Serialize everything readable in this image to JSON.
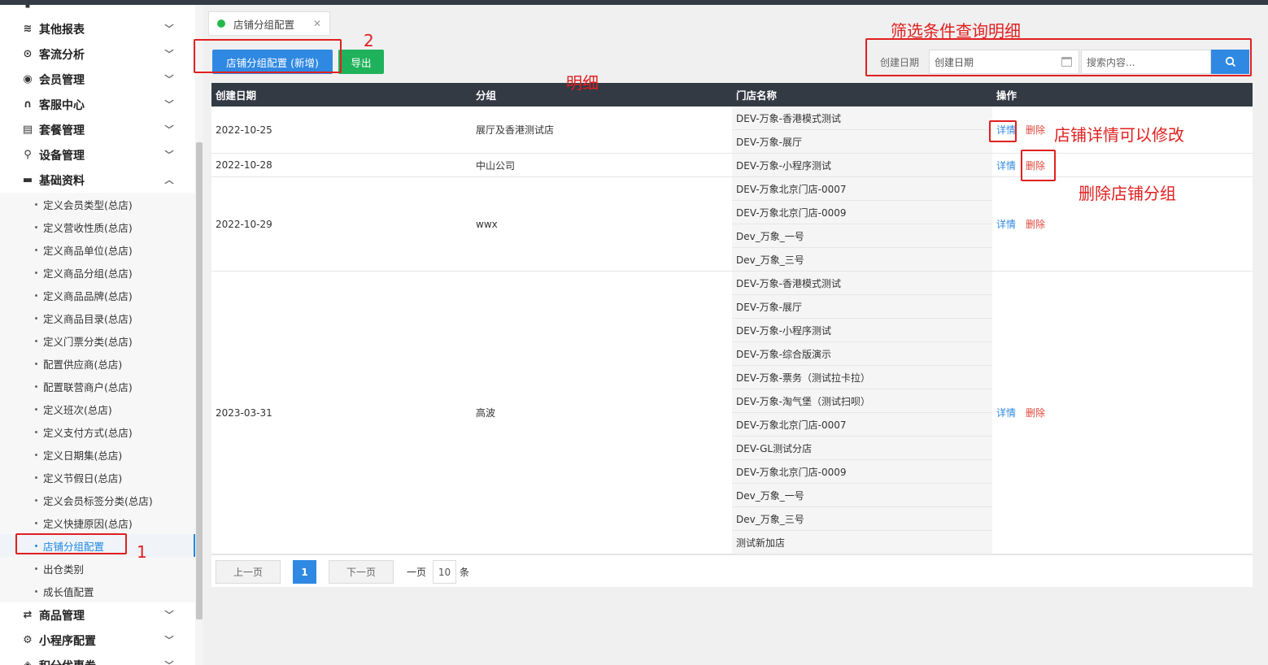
{
  "sidebar": {
    "menus_top": [
      {
        "label": "",
        "icon": "report-icon"
      },
      {
        "label": "其他报表",
        "icon": "layers-icon"
      },
      {
        "label": "客流分析",
        "icon": "target-icon"
      },
      {
        "label": "会员管理",
        "icon": "user-icon"
      },
      {
        "label": "客服中心",
        "icon": "headset-icon"
      },
      {
        "label": "套餐管理",
        "icon": "package-icon"
      },
      {
        "label": "设备管理",
        "icon": "device-icon"
      },
      {
        "label": "基础资料",
        "icon": "document-icon"
      }
    ],
    "sub_items": [
      "定义会员类型(总店)",
      "定义营收性质(总店)",
      "定义商品单位(总店)",
      "定义商品分组(总店)",
      "定义商品品牌(总店)",
      "定义商品目录(总店)",
      "定义门票分类(总店)",
      "配置供应商(总店)",
      "配置联营商户(总店)",
      "定义班次(总店)",
      "定义支付方式(总店)",
      "定义日期集(总店)",
      "定义节假日(总店)",
      "定义会员标签分类(总店)",
      "定义快捷原因(总店)",
      "店铺分组配置",
      "出仓类别",
      "成长值配置"
    ],
    "active_index": 15,
    "menus_bottom": [
      {
        "label": "商品管理",
        "icon": "swap-icon"
      },
      {
        "label": "小程序配置",
        "icon": "gear-icon"
      },
      {
        "label": "积分优惠券",
        "icon": "coupon-icon"
      }
    ]
  },
  "tab": {
    "label": "店铺分组配置"
  },
  "toolbar": {
    "add_label": "店铺分组配置 (新增)",
    "export_label": "导出"
  },
  "filter": {
    "date_label": "创建日期",
    "date_placeholder": "创建日期",
    "search_placeholder": "搜索内容..."
  },
  "table": {
    "headers": [
      "创建日期",
      "分组",
      "门店名称",
      "操作"
    ],
    "groups": [
      {
        "date": "2022-10-25",
        "group": "展厅及香港测试店",
        "stores": [
          "DEV-万象-香港模式测试",
          "DEV-万象-展厅"
        ]
      },
      {
        "date": "2022-10-28",
        "group": "中山公司",
        "stores": [
          "DEV-万象-小程序测试"
        ]
      },
      {
        "date": "2022-10-29",
        "group": "wwx",
        "stores": [
          "DEV-万象北京门店-0007",
          "DEV-万象北京门店-0009",
          "Dev_万象_一号",
          "Dev_万象_三号"
        ]
      },
      {
        "date": "2023-03-31",
        "group": "高波",
        "stores": [
          "DEV-万象-香港模式测试",
          "DEV-万象-展厅",
          "DEV-万象-小程序测试",
          "DEV-万象-综合版演示",
          "DEV-万象-票务（测试拉卡拉）",
          "DEV-万象-淘气堡（测试扫呗）",
          "DEV-万象北京门店-0007",
          "DEV-GL测试分店",
          "DEV-万象北京门店-0009",
          "Dev_万象_一号",
          "Dev_万象_三号",
          "测试新加店"
        ]
      }
    ],
    "op_detail": "详情",
    "op_delete": "删除"
  },
  "pager": {
    "prev": "上一页",
    "current": "1",
    "next": "下一页",
    "per_page_prefix": "一页",
    "per_page": "10",
    "per_page_suffix": "条"
  },
  "annotations": {
    "filter_note": "筛选条件查询明细",
    "detail_note": "明细",
    "edit_note": "店铺详情可以修改",
    "delete_note": "删除店铺分组",
    "num_1": "1",
    "num_2": "2"
  },
  "colors": {
    "primary": "#2f89e3",
    "success": "#1fb25a",
    "danger": "#e0463c",
    "header_dark": "#333a44",
    "annotation": "#e02020"
  }
}
